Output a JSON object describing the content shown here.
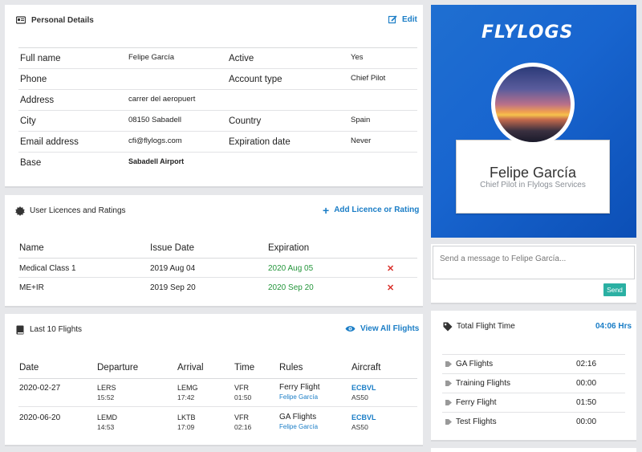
{
  "personal": {
    "title": "Personal Details",
    "edit_label": "Edit",
    "fields": [
      {
        "label": "Full name",
        "value": "Felipe García",
        "label2": "Active",
        "value2": "Yes"
      },
      {
        "label": "Phone",
        "value": "",
        "label2": "Account type",
        "value2": "Chief Pilot"
      },
      {
        "label": "Address",
        "value": "carrer del aeropuert",
        "label2": "",
        "value2": ""
      },
      {
        "label": "City",
        "value": "08150 Sabadell",
        "label2": "Country",
        "value2": "Spain"
      },
      {
        "label": "Email address",
        "value": "cfi@flylogs.com",
        "label2": "Expiration date",
        "value2": "Never"
      },
      {
        "label": "Base",
        "value": "Sabadell Airport",
        "label2": "",
        "value2": ""
      }
    ]
  },
  "licences": {
    "title": "User Licences and Ratings",
    "add_label": "Add Licence or Rating",
    "columns": [
      "Name",
      "Issue Date",
      "Expiration"
    ],
    "rows": [
      {
        "name": "Medical Class 1",
        "issue": "2019 Aug 04",
        "expiration": "2020 Aug 05"
      },
      {
        "name": "ME+IR",
        "issue": "2019 Sep 20",
        "expiration": "2020 Sep 20"
      }
    ]
  },
  "flights": {
    "title": "Last 10 Flights",
    "view_all_label": "View All Flights",
    "columns": [
      "Date",
      "Departure",
      "Arrival",
      "Time",
      "Rules",
      "Aircraft"
    ],
    "rows": [
      {
        "date": "2020-02-27",
        "dep": "LERS",
        "dep_time": "15:52",
        "arr": "LEMG",
        "arr_time": "17:42",
        "rules": "VFR",
        "time": "01:50",
        "type": "Ferry Flight",
        "pilot": "Felipe García",
        "aircraft": "ECBVL",
        "model": "AS50"
      },
      {
        "date": "2020-06-20",
        "dep": "LEMD",
        "dep_time": "14:53",
        "arr": "LKTB",
        "arr_time": "17:09",
        "rules": "VFR",
        "time": "02:16",
        "type": "GA Flights",
        "pilot": "Felipe García",
        "aircraft": "ECBVL",
        "model": "AS50"
      }
    ]
  },
  "profile": {
    "logo": "FLYLOGS",
    "name": "Felipe García",
    "role": "Chief Pilot in Flylogs Services"
  },
  "message": {
    "placeholder": "Send a message to Felipe García...",
    "send_label": "Send"
  },
  "flight_time": {
    "title": "Total Flight Time",
    "total": "04:06 Hrs",
    "rows": [
      {
        "label": "GA Flights",
        "value": "02:16"
      },
      {
        "label": "Training Flights",
        "value": "00:00"
      },
      {
        "label": "Ferry Flight",
        "value": "01:50"
      },
      {
        "label": "Test Flights",
        "value": "00:00"
      }
    ]
  },
  "colors": {
    "accent": "#1a7dc6",
    "send": "#2bb0a3",
    "ok": "#25963c",
    "delete": "#d9312b",
    "profile_bg": "#1865cf"
  }
}
